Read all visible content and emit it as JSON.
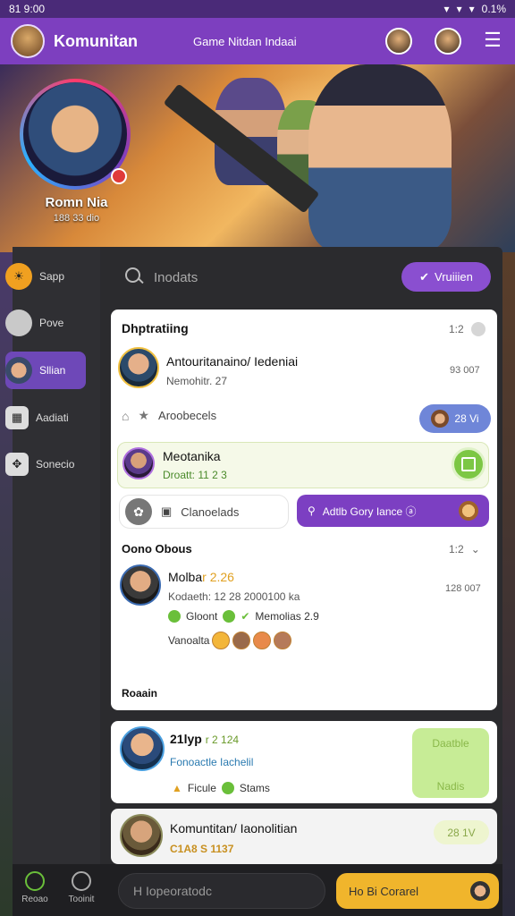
{
  "status_bar": {
    "time": "81 9:00",
    "battery": "0.1%"
  },
  "top_bar": {
    "app_title": "Komunitan",
    "subtitle": "Game Nitdan Indaai"
  },
  "profile": {
    "name": "Romn Nia",
    "meta": "188 33 dio"
  },
  "sidebar": {
    "items": [
      {
        "label": "Sapp",
        "icon": "sun-icon"
      },
      {
        "label": "Pove",
        "icon": "avatar-icon"
      },
      {
        "label": "Sllian",
        "icon": "avatar-icon"
      },
      {
        "label": "Aadiati",
        "icon": "grid-icon"
      },
      {
        "label": "Sonecio",
        "icon": "puzzle-icon"
      }
    ]
  },
  "search": {
    "placeholder": "Inodats"
  },
  "primary_button": {
    "label": "Vruiiien"
  },
  "section_top": {
    "title": "Dhptratiing",
    "count": "1:2"
  },
  "post_1": {
    "name": "Antouritanaino/ Iedeniai",
    "sub": "Nemohitr. 27",
    "time": "93 007"
  },
  "reaction_row": {
    "label": "Aroobecels",
    "pill": "28 Vi"
  },
  "highlight_row": {
    "name": "Meotanika",
    "sub": "Droatt: 11 2 3"
  },
  "actions": {
    "left_label": "Clanoelads",
    "purple_label": "Adtlb Gory Iance ⓐ"
  },
  "section_bottom": {
    "title": "Oono Obous",
    "count": "1:2"
  },
  "post_2": {
    "name_prefix": "Molba",
    "name_suffix": "r 2.26",
    "sub": "Kodaeth: 12 28 2000100 ka",
    "time": "128 007",
    "status_a": "Gloont",
    "status_b": "Memolias 2.9",
    "emoji_label": "Vanoalta"
  },
  "footer_label": "Roaain",
  "post_3": {
    "name": "21lyp",
    "name_tag": "r 2 124",
    "sub": "Fonoactle Iachelil",
    "chip_a": "Ficule",
    "chip_b": "Stams",
    "green_top": "Daatble",
    "green_bottom": "Nadis"
  },
  "post_4": {
    "name": "Komuntitan/ Iaonolitian",
    "sub": "C1A8 S 1137",
    "pill": "28 1V"
  },
  "bottom_nav": {
    "items": [
      {
        "label": "Reoao"
      },
      {
        "label": "Tooinit"
      }
    ],
    "compose_placeholder": "H Iopeoratodc",
    "cta": "Ho Bi Corarel"
  }
}
